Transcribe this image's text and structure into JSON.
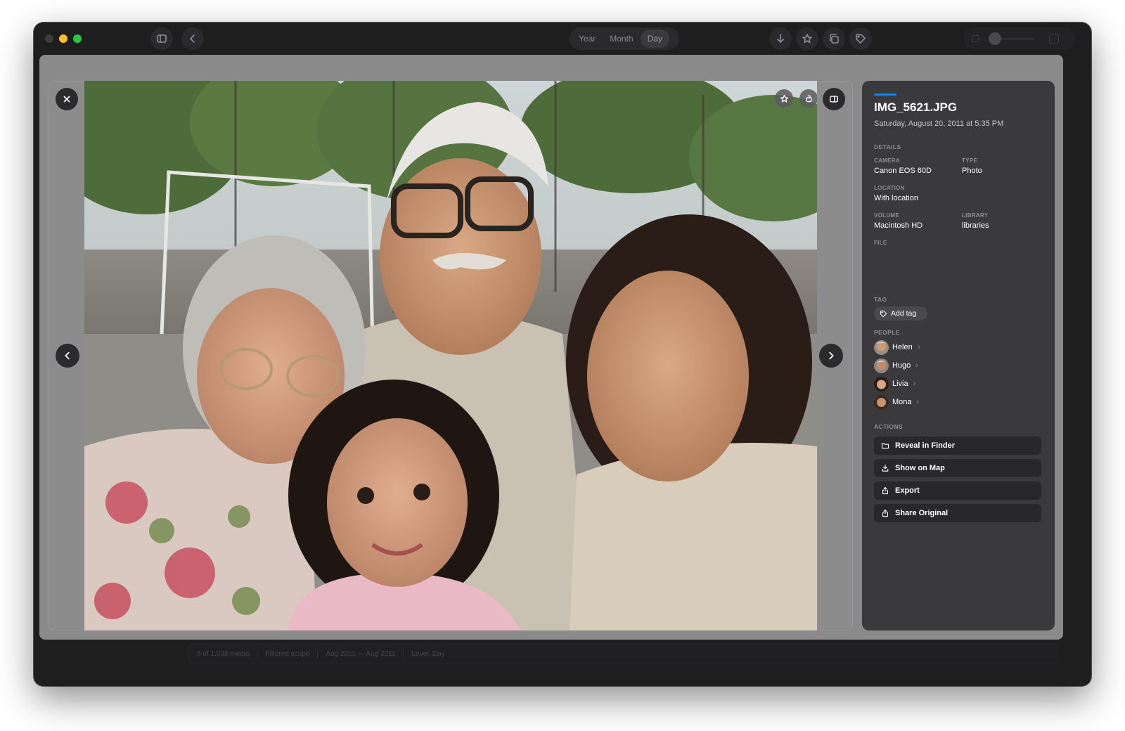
{
  "toolbar": {
    "view_segments": [
      {
        "label": "Year",
        "active": false
      },
      {
        "label": "Month",
        "active": false
      },
      {
        "label": "Day",
        "active": true
      }
    ],
    "buttons": [
      "sidebar-toggle-icon",
      "back-chevron-icon",
      "download-icon",
      "star-icon",
      "duplicate-icon",
      "tag-icon"
    ]
  },
  "viewer": {
    "photo_description_icons": [
      "favorite-star-icon",
      "rotate-icon",
      "info-panel-toggle-icon"
    ],
    "controls": [
      "close-icon",
      "previous-chevron-icon",
      "next-chevron-icon"
    ]
  },
  "panel": {
    "filename": "IMG_5621.JPG",
    "datetime": "Saturday, August 20, 2011 at 5:35 PM",
    "details_label": "DETAILS",
    "camera_label": "CAMERA",
    "camera_value": "Canon EOS 60D",
    "type_label": "TYPE",
    "type_value": "Photo",
    "location_label": "LOCATION",
    "location_value": "With location",
    "volume_label": "VOLUME",
    "volume_value": "Macintosh HD",
    "library_label": "LIBRARY",
    "library_value": "libraries",
    "file_label": "FILE",
    "tag_label": "TAG",
    "add_tag": "Add tag",
    "people_label": "PEOPLE",
    "people": [
      {
        "name": "Helen"
      },
      {
        "name": "Hugo"
      },
      {
        "name": "Livia"
      },
      {
        "name": "Mona"
      }
    ],
    "actions_label": "ACTIONS",
    "actions": [
      {
        "label": "Reveal in Finder",
        "icon": "folder-icon"
      },
      {
        "label": "Show on Map",
        "icon": "map-pin-icon"
      },
      {
        "label": "Export",
        "icon": "share-icon"
      },
      {
        "label": "Share Original",
        "icon": "share-icon"
      }
    ]
  },
  "statusbar": {
    "count": "5 of 1,038 media",
    "scope": "Filtered scope",
    "range": "Aug 2011 — Aug 2011",
    "level": "Level: Day"
  },
  "colors": {
    "accent": "#0a84ff",
    "window_bg": "#1e1e1f",
    "panel_bg": "#3a3a3c",
    "viewer_bg": "#8a8a8a"
  }
}
